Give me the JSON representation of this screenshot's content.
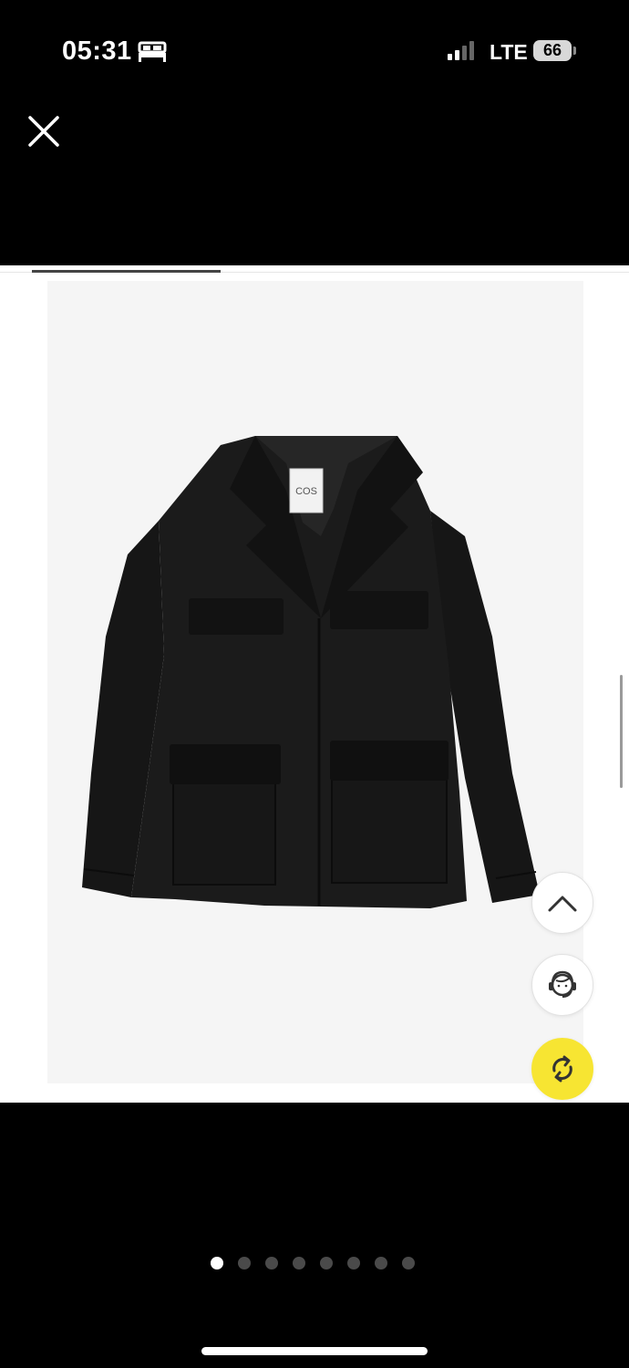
{
  "status_bar": {
    "time": "05:31",
    "network": "LTE",
    "battery": "66",
    "icons": [
      "bed-icon",
      "signal-bars-icon",
      "battery-icon"
    ]
  },
  "toolbar": {
    "close_icon": "close-icon"
  },
  "product_image": {
    "brand_label": "COS",
    "subject": "black utility jacket"
  },
  "floating_actions": [
    "chevron-up-icon",
    "customer-support-icon",
    "convert-icon"
  ],
  "colors": {
    "accent": "#f7e532",
    "background": "#000000",
    "image_bg": "#f5f5f5"
  },
  "gallery": {
    "total_images": 8,
    "active_index": 0
  }
}
